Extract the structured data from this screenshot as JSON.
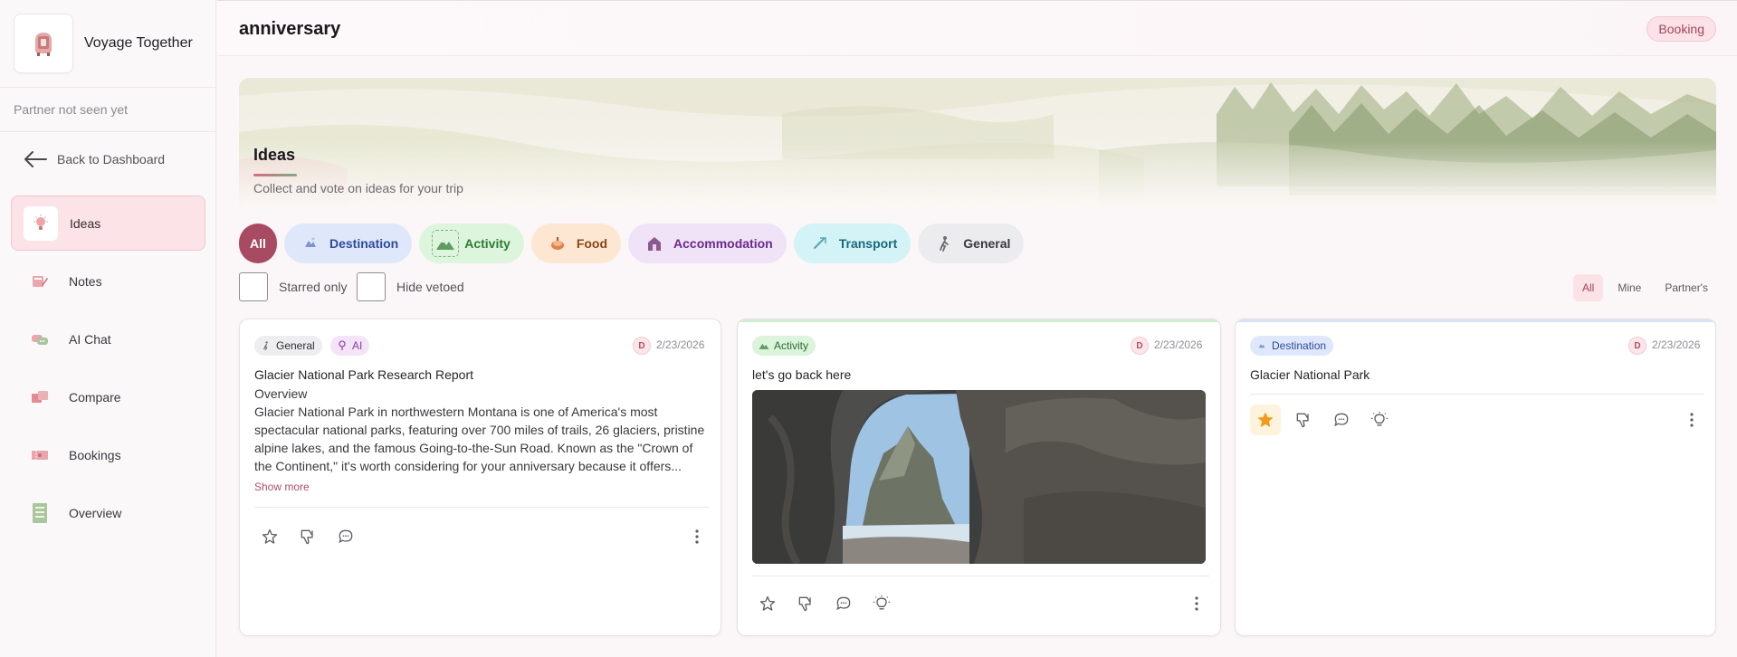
{
  "app": {
    "name": "Voyage Together",
    "presence": "Partner not seen yet"
  },
  "sidebar": {
    "back_label": "Back to Dashboard",
    "items": [
      {
        "label": "Ideas",
        "icon": "lightbulb-icon",
        "active": true
      },
      {
        "label": "Notes",
        "icon": "notes-icon",
        "active": false
      },
      {
        "label": "AI Chat",
        "icon": "chat-bubbles-icon",
        "active": false
      },
      {
        "label": "Compare",
        "icon": "compare-icon",
        "active": false
      },
      {
        "label": "Bookings",
        "icon": "ticket-icon",
        "active": false
      },
      {
        "label": "Overview",
        "icon": "checklist-icon",
        "active": false
      }
    ]
  },
  "header": {
    "title": "anniversary",
    "booking_label": "Booking"
  },
  "banner": {
    "title": "Ideas",
    "subtitle": "Collect and vote on ideas for your trip"
  },
  "filters": {
    "chips": [
      {
        "label": "All",
        "active": true
      },
      {
        "label": "Destination"
      },
      {
        "label": "Activity"
      },
      {
        "label": "Food"
      },
      {
        "label": "Accommodation"
      },
      {
        "label": "Transport"
      },
      {
        "label": "General"
      }
    ],
    "starred_only": "Starred only",
    "hide_vetoed": "Hide vetoed",
    "owner": [
      "All",
      "Mine",
      "Partner's"
    ],
    "owner_active": "All"
  },
  "cards": [
    {
      "category": "General",
      "badge": "AI",
      "author_initial": "D",
      "date": "2/23/2026",
      "title": "Glacier National Park Research Report",
      "body_heading": "Overview",
      "body": "Glacier National Park in northwestern Montana is one of America's most spectacular national parks, featuring over 700 miles of trails, 26 glaciers, pristine alpine lakes, and the famous Going-to-the-Sun Road. Known as the \"Crown of the Continent,\" it's worth considering for your anniversary because it offers...",
      "show_more": "Show more",
      "starred": false
    },
    {
      "category": "Activity",
      "author_initial": "D",
      "date": "2/23/2026",
      "title": "let's go back here",
      "image": "sea-arch-photo",
      "starred": false
    },
    {
      "category": "Destination",
      "author_initial": "D",
      "date": "2/23/2026",
      "title": "Glacier National Park",
      "starred": true
    }
  ],
  "colors": {
    "accent": "#a84a62",
    "star": "#f29a1b"
  }
}
